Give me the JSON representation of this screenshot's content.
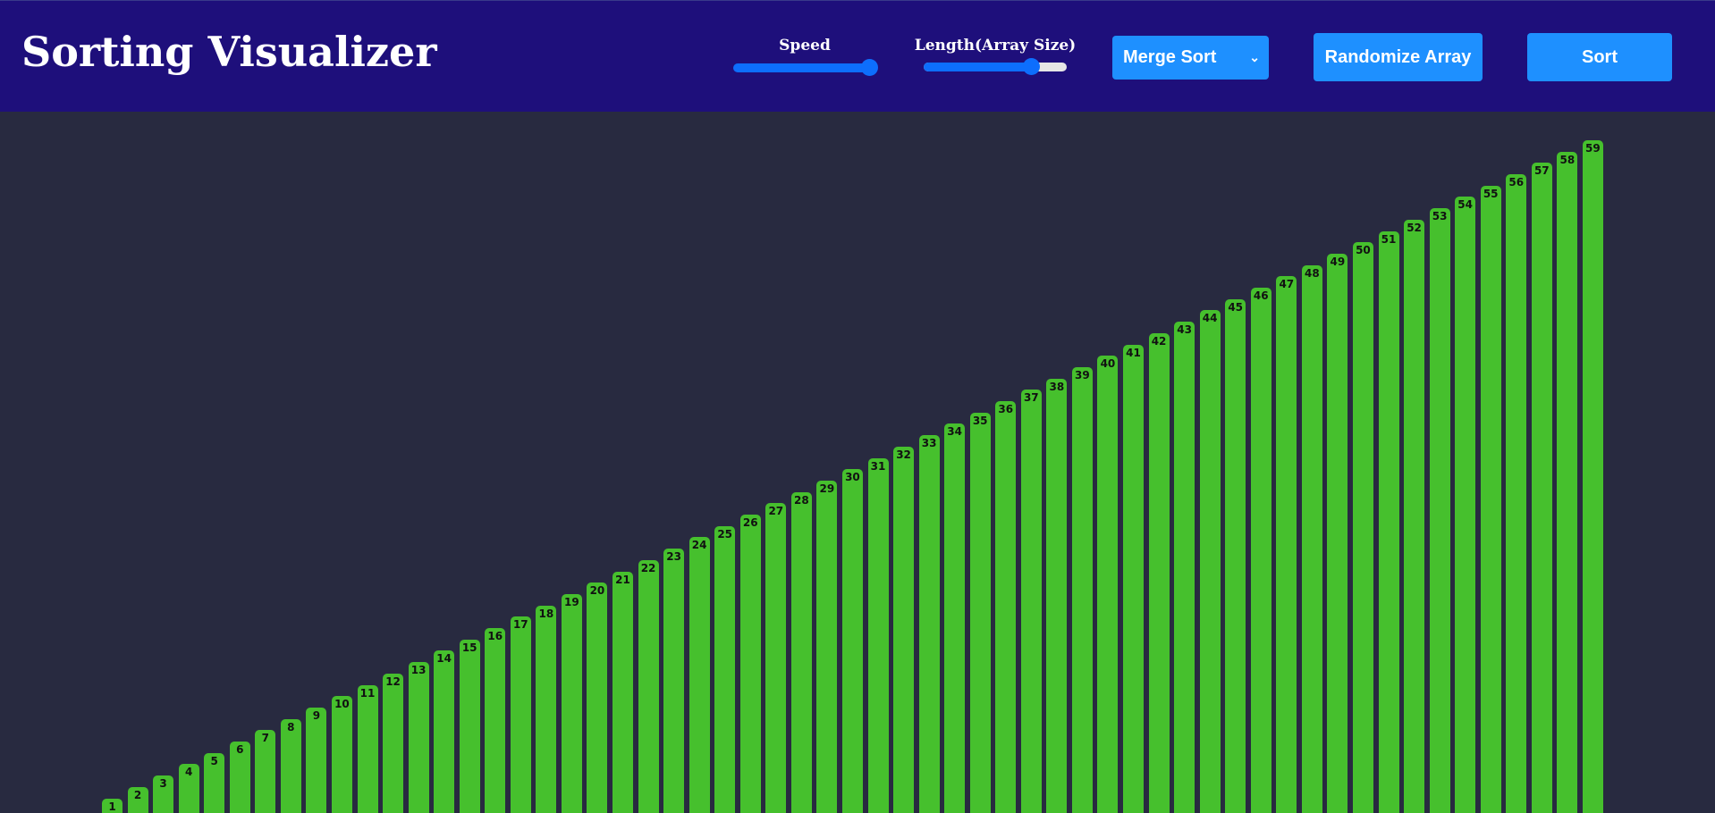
{
  "header": {
    "title": "Sorting Visualizer",
    "speed_label": "Speed",
    "length_label": "Length(Array Size)",
    "speed_level": 0.95,
    "length_level": 0.75,
    "algorithm_selected": "Merge Sort",
    "randomize_label": "Randomize Array",
    "sort_label": "Sort"
  },
  "colors": {
    "header_bg": "#1e0f7b",
    "page_bg": "#282a40",
    "accent": "#1e90ff",
    "slider": "#0d6efd",
    "bar": "#46c02d"
  },
  "chart_data": {
    "type": "bar",
    "values": [
      1,
      2,
      3,
      4,
      5,
      6,
      7,
      8,
      9,
      10,
      11,
      12,
      13,
      14,
      15,
      16,
      17,
      18,
      19,
      20,
      21,
      22,
      23,
      24,
      25,
      26,
      27,
      28,
      29,
      30,
      31,
      32,
      33,
      34,
      35,
      36,
      37,
      38,
      39,
      40,
      41,
      42,
      43,
      44,
      45,
      46,
      47,
      48,
      49,
      50,
      51,
      52,
      53,
      54,
      55,
      56,
      57,
      58,
      59
    ]
  }
}
